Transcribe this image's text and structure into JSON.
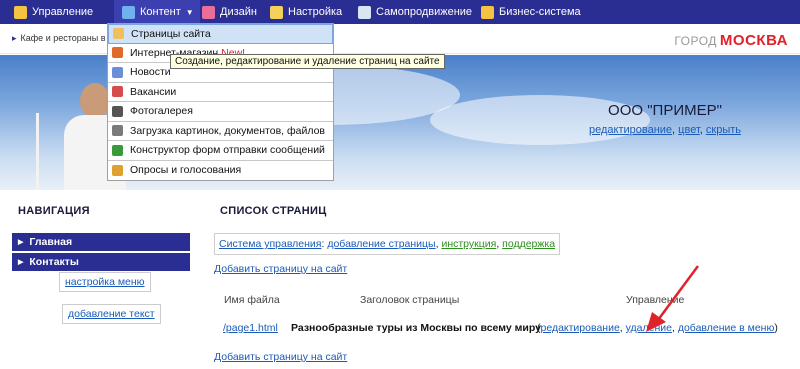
{
  "topbar": {
    "items": [
      {
        "label": "Управление",
        "icon": "home-icon",
        "color": "#f5c242"
      },
      {
        "label": "Контент",
        "icon": "content-icon",
        "color": "#6fb1ee"
      },
      {
        "label": "Дизайн",
        "icon": "palette-icon",
        "color": "#e96f9b"
      },
      {
        "label": "Настройка",
        "icon": "settings-icon",
        "color": "#f2d25a"
      },
      {
        "label": "Самопродвижение",
        "icon": "document-icon",
        "color": "#d9e4f5"
      },
      {
        "label": "Бизнес-система",
        "icon": "business-icon",
        "color": "#f5c242"
      }
    ]
  },
  "breadcrumb": {
    "text": "Кафе и рестораны в"
  },
  "city": {
    "prefix": "ГОРОД",
    "name": "МОСКВА"
  },
  "company": {
    "name": "ООО \"ПРИМЕР\"",
    "links": [
      "редактирование",
      "цвет",
      "скрыть"
    ]
  },
  "dropdown": {
    "items": [
      {
        "label": "Страницы сайта",
        "icon": "pages-icon",
        "color": "#f0c060"
      },
      {
        "label": "Интернет-магазин",
        "badge": "New!",
        "icon": "shop-icon",
        "color": "#e06a2a"
      },
      {
        "label": "Новости",
        "icon": "news-icon",
        "color": "#6a8fd8"
      },
      {
        "label": "Вакансии",
        "icon": "jobs-icon",
        "color": "#d64b4b"
      },
      {
        "label": "Фотогалерея",
        "icon": "camera-icon",
        "color": "#555555"
      },
      {
        "label": "Загрузка картинок, документов, файлов",
        "icon": "upload-icon",
        "color": "#7a7a7a"
      },
      {
        "label": "Конструктор форм отправки сообщений",
        "icon": "form-check-icon",
        "color": "#3a9a3a"
      },
      {
        "label": "Опросы и голосования",
        "icon": "poll-icon",
        "color": "#e0a030"
      }
    ],
    "tooltip": "Создание, редактирование и удаление страниц на сайте"
  },
  "nav": {
    "title": "НАВИГАЦИЯ",
    "items": [
      "Главная",
      "Контакты"
    ],
    "edit_menu": "настройка меню",
    "edit_text": "добавление текст"
  },
  "main": {
    "title": "СПИСОК СТРАНИЦ",
    "sys_label": "Система управления",
    "sys_add": "добавление страницы",
    "sys_instr": "инструкция",
    "sys_support": "поддержка",
    "add_page": "Добавить страницу на сайт",
    "columns": [
      "Имя файла",
      "Заголовок страницы",
      "Управление"
    ],
    "row": {
      "file": "/page1.html",
      "title": "Разнообразные туры из Москвы по всему миру",
      "actions": [
        "редактирование",
        "удаление",
        "добавление в меню"
      ]
    }
  }
}
